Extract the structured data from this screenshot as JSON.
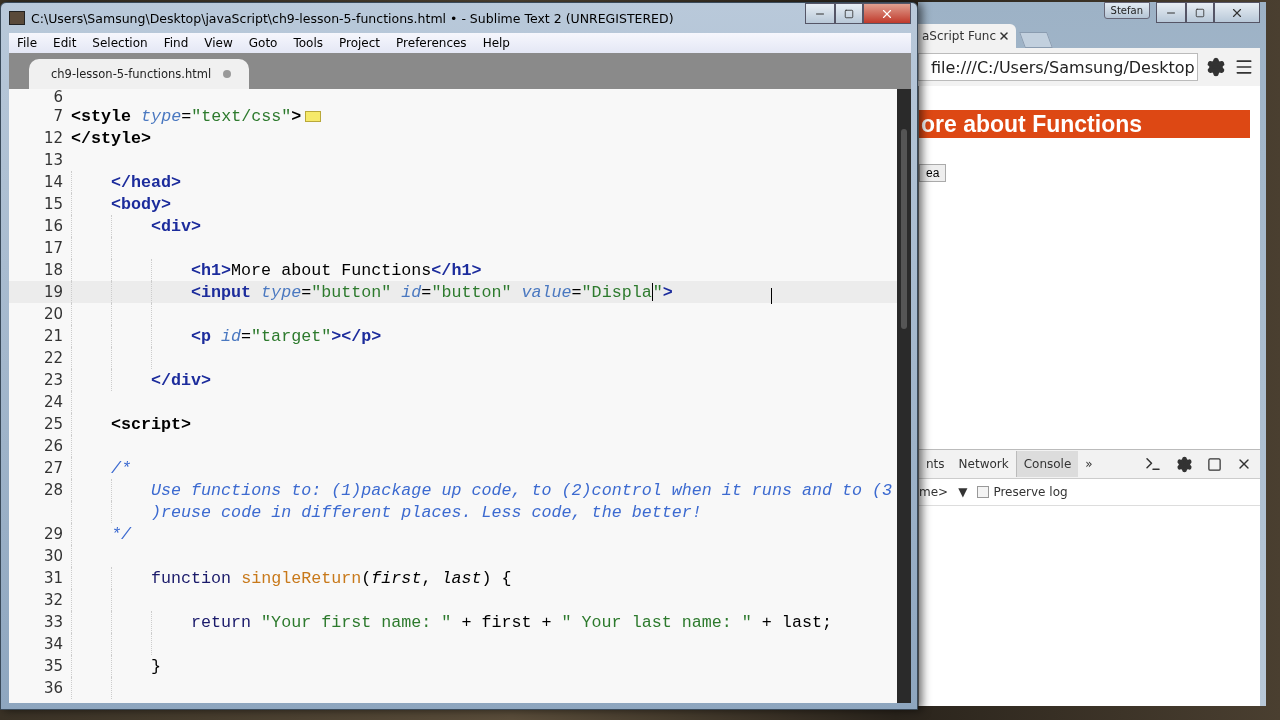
{
  "editor": {
    "title": "C:\\Users\\Samsung\\Desktop\\javaScript\\ch9-lesson-5-functions.html • - Sublime Text 2 (UNREGISTERED)",
    "menu": [
      "File",
      "Edit",
      "Selection",
      "Find",
      "View",
      "Goto",
      "Tools",
      "Project",
      "Preferences",
      "Help"
    ],
    "tabs": [
      {
        "label": "ch9-lesson-5-functions.html",
        "selected": true,
        "modified": true
      }
    ],
    "lines": [
      {
        "number": "6",
        "current": false
      },
      {
        "number": "7",
        "current": false,
        "folded": true,
        "tokens": [
          {
            "kind": "embed",
            "text": "<style "
          },
          {
            "kind": "attr",
            "text": "type"
          },
          {
            "kind": "plain",
            "text": "="
          },
          {
            "kind": "string",
            "text": "\"text/css\""
          },
          {
            "kind": "embed",
            "text": ">"
          }
        ]
      },
      {
        "number": "12",
        "current": false,
        "tokens": [
          {
            "kind": "embed",
            "text": "</style>"
          }
        ]
      },
      {
        "number": "13",
        "current": false
      },
      {
        "children": [
          {
            "number": "14",
            "current": false,
            "tokens": [
              {
                "kind": "tag",
                "text": "</head>"
              }
            ]
          },
          {
            "number": "15",
            "current": false,
            "tokens": [
              {
                "kind": "tag",
                "text": "<body>"
              }
            ]
          },
          {
            "children": [
              {
                "number": "16",
                "current": false,
                "tokens": [
                  {
                    "kind": "tag",
                    "text": "<div>"
                  }
                ]
              },
              {
                "number": "17",
                "current": false
              },
              {
                "children": [
                  {
                    "number": "18",
                    "current": false,
                    "tokens": [
                      {
                        "kind": "tag",
                        "text": "<h1>"
                      },
                      {
                        "kind": "plain",
                        "text": "More about Functions"
                      },
                      {
                        "kind": "tag",
                        "text": "</h1>"
                      }
                    ]
                  },
                  {
                    "number": "19",
                    "current": true,
                    "tokens": [
                      {
                        "kind": "tag",
                        "text": "<input "
                      },
                      {
                        "kind": "attr",
                        "text": "type"
                      },
                      {
                        "kind": "plain",
                        "text": "="
                      },
                      {
                        "kind": "string",
                        "text": "\"button\" "
                      },
                      {
                        "kind": "attr",
                        "text": "id"
                      },
                      {
                        "kind": "plain",
                        "text": "="
                      },
                      {
                        "kind": "string",
                        "text": "\"button\" "
                      },
                      {
                        "kind": "attr",
                        "text": "value"
                      },
                      {
                        "kind": "plain",
                        "text": "="
                      },
                      {
                        "kind": "string",
                        "text": "\"Displa"
                      },
                      {
                        "kind": "caret"
                      },
                      {
                        "kind": "string",
                        "text": "\""
                      },
                      {
                        "kind": "tag",
                        "text": ">"
                      }
                    ]
                  },
                  {
                    "number": "20",
                    "current": false
                  },
                  {
                    "number": "21",
                    "current": false,
                    "tokens": [
                      {
                        "kind": "tag",
                        "text": "<p "
                      },
                      {
                        "kind": "attr",
                        "text": "id"
                      },
                      {
                        "kind": "plain",
                        "text": "="
                      },
                      {
                        "kind": "string",
                        "text": "\"target\""
                      },
                      {
                        "kind": "tag",
                        "text": "></p>"
                      }
                    ]
                  },
                  {
                    "number": "22",
                    "current": false
                  }
                ]
              },
              {
                "number": "23",
                "current": false,
                "tokens": [
                  {
                    "kind": "tag",
                    "text": "</div>"
                  }
                ]
              }
            ]
          },
          {
            "number": "24",
            "current": false
          },
          {
            "number": "25",
            "current": false,
            "tokens": [
              {
                "kind": "embed",
                "text": "<script>"
              }
            ]
          },
          {
            "number": "26",
            "current": false
          },
          {
            "number": "27",
            "current": false,
            "tokens": [
              {
                "kind": "comment",
                "text": "/*"
              }
            ]
          },
          {
            "children": [
              {
                "number": "28",
                "current": false,
                "tokens": [
                  {
                    "kind": "comment",
                    "text": "Use functions to: (1)package up code, to (2)control when it runs and to (3"
                  }
                ]
              },
              {
                "current": false,
                "tokens": [
                  {
                    "kind": "comment",
                    "text": ")reuse code in different places. Less code, the better!"
                  }
                ]
              }
            ]
          },
          {
            "number": "29",
            "current": false,
            "tokens": [
              {
                "kind": "comment",
                "text": "*/"
              }
            ]
          },
          {
            "number": "30",
            "current": false
          },
          {
            "children": [
              {
                "number": "31",
                "current": false,
                "tokens": [
                  {
                    "kind": "keyword",
                    "text": "function "
                  },
                  {
                    "kind": "func",
                    "text": "singleReturn"
                  },
                  {
                    "kind": "plain",
                    "text": "("
                  },
                  {
                    "kind": "param",
                    "text": "first"
                  },
                  {
                    "kind": "plain",
                    "text": ", "
                  },
                  {
                    "kind": "param",
                    "text": "last"
                  },
                  {
                    "kind": "plain",
                    "text": ") {"
                  }
                ]
              },
              {
                "number": "32",
                "current": false
              },
              {
                "children": [
                  {
                    "number": "33",
                    "current": false,
                    "tokens": [
                      {
                        "kind": "keyword",
                        "text": "return "
                      },
                      {
                        "kind": "string",
                        "text": "\"Your first name: \""
                      },
                      {
                        "kind": "plain",
                        "text": " + first + "
                      },
                      {
                        "kind": "string",
                        "text": "\" Your last name: \""
                      },
                      {
                        "kind": "plain",
                        "text": " + last;"
                      }
                    ]
                  },
                  {
                    "number": "34",
                    "current": false
                  }
                ]
              },
              {
                "number": "35",
                "current": false,
                "tokens": [
                  {
                    "kind": "plain",
                    "text": "}"
                  }
                ]
              },
              {
                "number": "36",
                "current": false
              }
            ]
          }
        ]
      }
    ]
  },
  "browser": {
    "user": "Stefan",
    "tab": {
      "label": "aScript Func",
      "selected": true
    },
    "address": "file:///C:/Users/Samsung/Desktop",
    "heading": "ore about Functions",
    "button": "ea",
    "devtools": {
      "tabs": [
        {
          "label": "nts",
          "selected": false
        },
        {
          "label": "Network",
          "selected": false
        },
        {
          "label": "Console",
          "selected": true
        }
      ],
      "more": "»",
      "context": "me>",
      "dropdown": "▼",
      "preserve_log": {
        "label": "Preserve log",
        "checked": false
      }
    }
  }
}
